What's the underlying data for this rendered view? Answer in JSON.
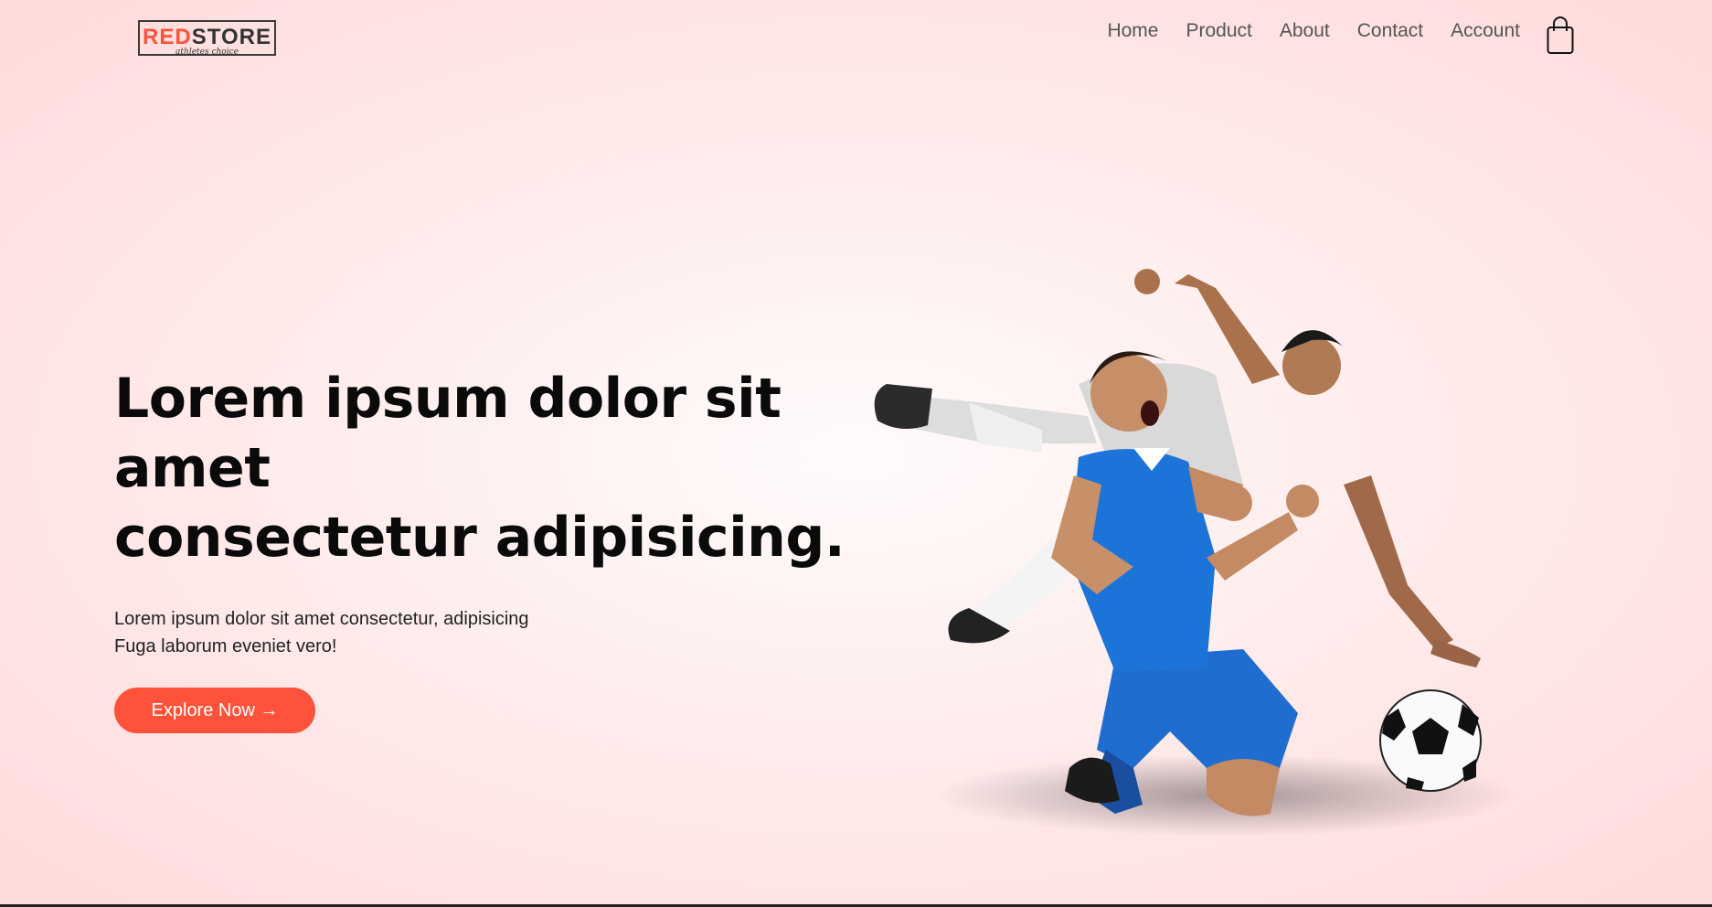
{
  "brand": {
    "logo_part1": "RED",
    "logo_part2": "STORE",
    "tagline": "athletes choice"
  },
  "nav": {
    "items": [
      "Home",
      "Product",
      "About",
      "Contact",
      "Account"
    ],
    "cart_icon": "shopping-bag-icon"
  },
  "hero": {
    "title_lines": [
      "Lorem ipsum dolor sit",
      "amet",
      "consectetur adipisicing."
    ],
    "subtitle_lines": [
      "Lorem ipsum dolor sit amet consectetur, adipisicing",
      "Fuga laborum eveniet vero!"
    ],
    "cta_label": "Explore Now →",
    "image": "soccer-players-celebration"
  },
  "colors": {
    "accent": "#ff523b",
    "background": "#ffe6e6",
    "text": "#0a0a0a"
  }
}
